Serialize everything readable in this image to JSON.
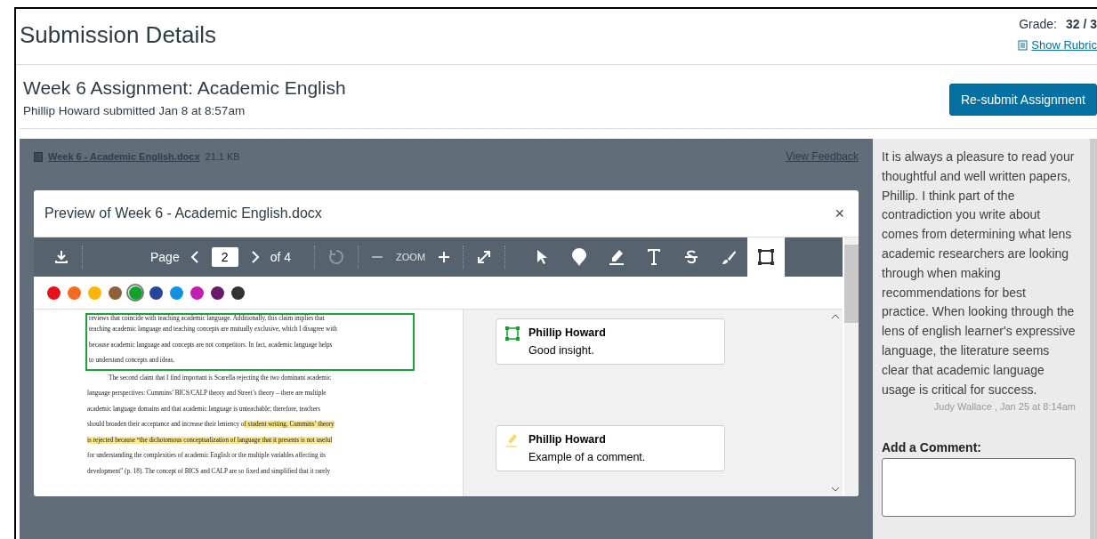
{
  "header": {
    "title": "Submission Details",
    "grade_label": "Grade:",
    "grade_value": "32 / 3",
    "rubric_link": "Show Rubric"
  },
  "assignment": {
    "title": "Week 6 Assignment: Academic English",
    "submitted": "Phillip Howard submitted Jan 8 at 8:57am",
    "resubmit_button": "Re-submit Assignment"
  },
  "file": {
    "name": "Week 6 - Academic English.docx",
    "size": "21.1 KB",
    "feedback_link": "View Feedback"
  },
  "preview": {
    "title": "Preview of Week 6 - Academic English.docx",
    "close": "×",
    "toolbar": {
      "page_label": "Page",
      "page_value": "2",
      "page_total": "of 4",
      "zoom_label": "ZOOM",
      "tools": [
        {
          "kind": "pointer",
          "selected": false
        },
        {
          "kind": "pin",
          "selected": false
        },
        {
          "kind": "highlight",
          "selected": false
        },
        {
          "kind": "text",
          "selected": false
        },
        {
          "kind": "strike",
          "selected": false
        },
        {
          "kind": "brush",
          "selected": false
        },
        {
          "kind": "area",
          "selected": true
        }
      ]
    },
    "colors": [
      {
        "color": "#e8101a",
        "selected": false
      },
      {
        "color": "#f36a21",
        "selected": false
      },
      {
        "color": "#fbb40a",
        "selected": false
      },
      {
        "color": "#8b6239",
        "selected": false
      },
      {
        "color": "#10a22b",
        "selected": true
      },
      {
        "color": "#24479a",
        "selected": false
      },
      {
        "color": "#1390e1",
        "selected": false
      },
      {
        "color": "#c21fb0",
        "selected": false
      },
      {
        "color": "#6a1a6b",
        "selected": false
      },
      {
        "color": "#333333",
        "selected": false
      }
    ],
    "document": [
      {
        "kind": "boxed",
        "lines": [
          {
            "indent": false,
            "parts": [
              {
                "text": "reviews that coincide with teaching academic language. Additionally, this claim implies that",
                "highlighted": false
              }
            ]
          },
          {
            "indent": false,
            "parts": [
              {
                "text": "teaching academic language and teaching concepts are mutually exclusive, which I disagree with",
                "highlighted": false
              }
            ]
          },
          {
            "indent": false,
            "parts": [
              {
                "text": "because academic language and concepts are not competitors. In fact, academic language helps",
                "highlighted": false
              }
            ]
          },
          {
            "indent": false,
            "parts": [
              {
                "text": "to understand concepts and ideas.",
                "highlighted": false
              }
            ]
          }
        ]
      },
      {
        "kind": "plain",
        "lines": [
          {
            "indent": true,
            "parts": [
              {
                "text": "The second claim that I find important is Scarella rejecting the two dominant academic",
                "highlighted": false
              }
            ]
          },
          {
            "indent": false,
            "parts": [
              {
                "text": "language perspectives: Cummins’ BICS/CALP theory and Street’s theory – there are multiple",
                "highlighted": false
              }
            ]
          },
          {
            "indent": false,
            "parts": [
              {
                "text": "academic language domains and that academic language is unteachable; therefore, teachers",
                "highlighted": false
              }
            ]
          },
          {
            "indent": false,
            "parts": [
              {
                "text": "should broaden their acceptance and increase their leniency o",
                "highlighted": false
              },
              {
                "text": "f student writing. Cummins’ theory",
                "highlighted": true
              }
            ]
          },
          {
            "indent": false,
            "parts": [
              {
                "text": "is rejected because “the dichotomous conceptualization of language that it presents is not useful",
                "highlighted": true
              }
            ]
          },
          {
            "indent": false,
            "parts": [
              {
                "text": "for understanding the complexities of academic English or the multiple variables affecting its",
                "highlighted": false
              }
            ]
          },
          {
            "indent": false,
            "parts": [
              {
                "text": "development” (p. 18). The concept of BICS and CALP are so fixed and simplified that it rarely",
                "highlighted": false
              }
            ]
          }
        ]
      }
    ],
    "annotations": [
      {
        "kind": "area",
        "author": "Phillip Howard",
        "text": "Good insight."
      },
      {
        "kind": "highlight",
        "author": "Phillip Howard",
        "text": "Example of a comment."
      }
    ]
  },
  "comments": {
    "items": [
      {
        "text": "It is always a pleasure to read your thoughtful and well written papers, Phillip. I think part of the contradiction you write about comes from determining what lens academic researchers are looking through when making recommendations for best practice.  When looking through the lens of english learner's expressive language, the literature seems clear that academic language usage is critical for success.",
        "meta": "Judy Wallace , Jan 25 at 8:14am"
      }
    ],
    "add_label": "Add a Comment:"
  }
}
